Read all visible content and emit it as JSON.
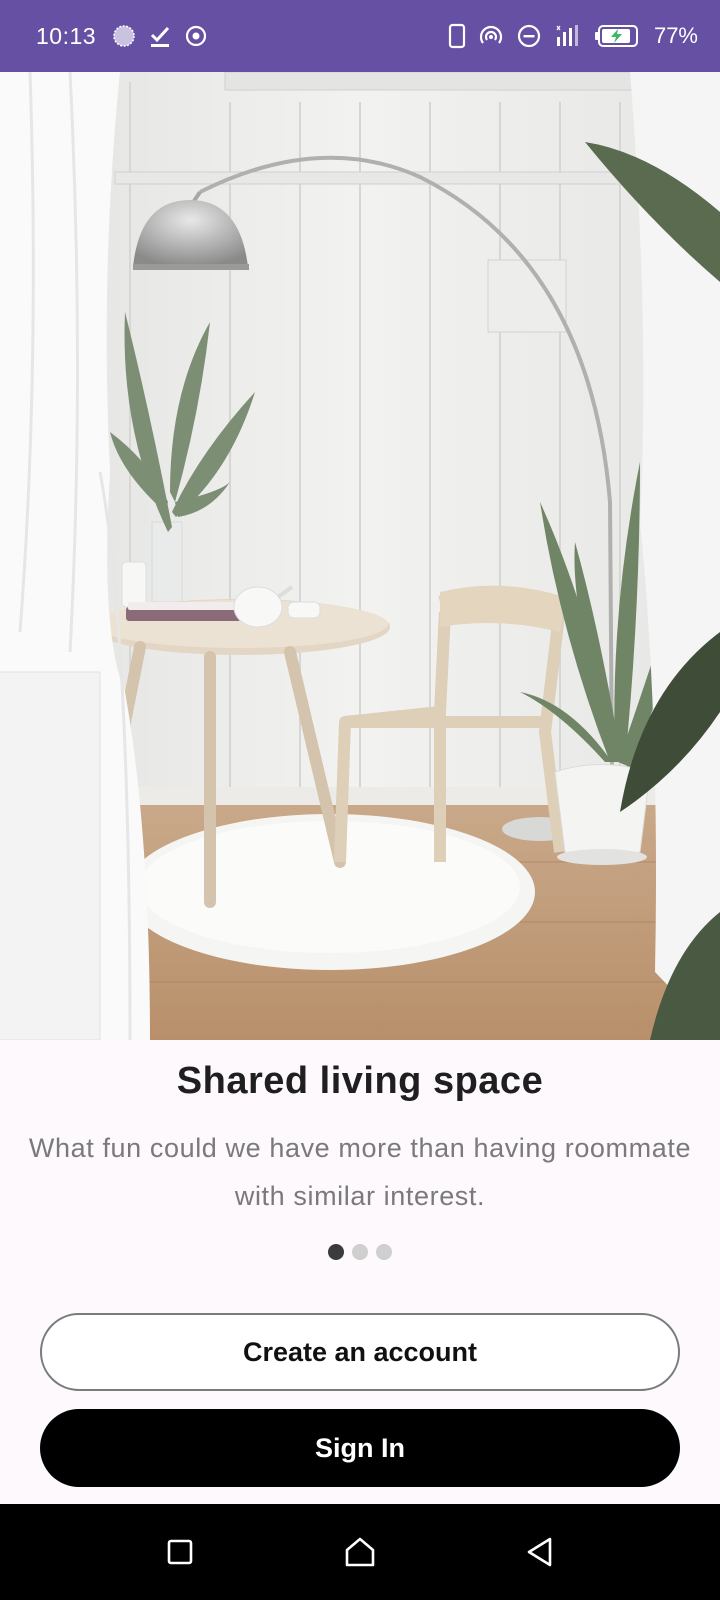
{
  "status_bar": {
    "time": "10:13",
    "battery": "77%",
    "background": "#6650a4",
    "left_icons": [
      "circle-dots-icon",
      "check-download-icon",
      "target-icon"
    ],
    "right_icons": [
      "phone-icon",
      "hotspot-icon",
      "dnd-icon",
      "signal-icon",
      "battery-charging-icon"
    ]
  },
  "hero": {
    "image": "living-room-photo"
  },
  "onboarding": {
    "title": "Shared living space",
    "subtitle": "What fun could we have more than having roommate with similar interest.",
    "pages": 3,
    "active_page": 0
  },
  "actions": {
    "create_account": "Create an account",
    "sign_in": "Sign In"
  },
  "nav": {
    "icons": [
      "recents-icon",
      "home-icon",
      "back-icon"
    ]
  }
}
